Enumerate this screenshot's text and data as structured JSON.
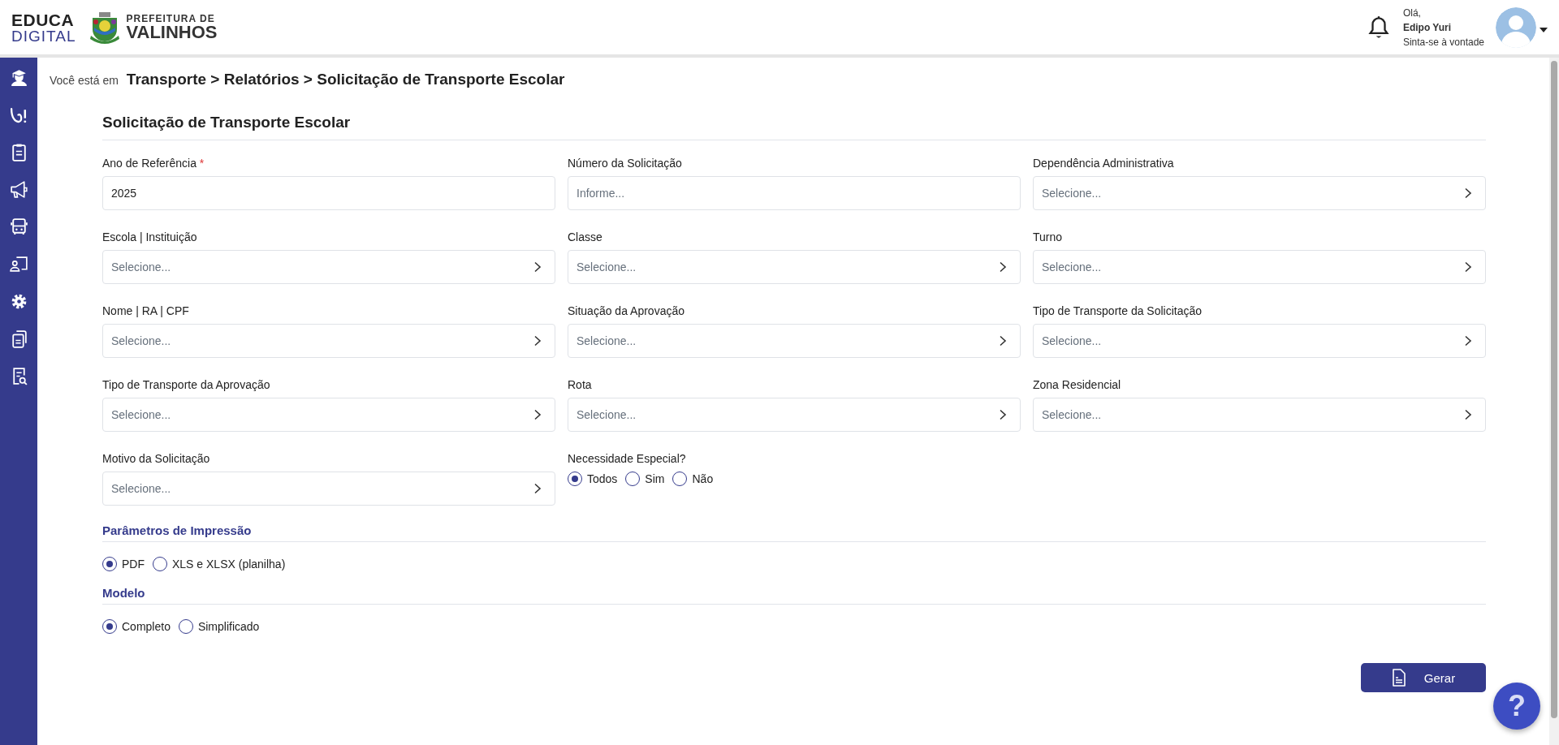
{
  "header": {
    "brand": {
      "line1": "EDUCA",
      "line2": "DIGITAL"
    },
    "city": {
      "line1": "PREFEITURA DE",
      "line2": "VALINHOS"
    },
    "user": {
      "greeting": "Olá,",
      "name": "Edipo Yuri",
      "subtitle": "Sinta-se à vontade"
    }
  },
  "breadcrumb": {
    "prefix": "Você está em",
    "path": "Transporte > Relatórios > Solicitação de Transporte Escolar"
  },
  "form": {
    "title": "Solicitação de Transporte Escolar",
    "fields": [
      {
        "kind": "text",
        "label": "Ano de Referência",
        "required_mark": "*",
        "value": "2025"
      },
      {
        "kind": "input",
        "label": "Número da Solicitação",
        "placeholder": "Informe..."
      },
      {
        "kind": "select",
        "label": "Dependência Administrativa",
        "placeholder": "Selecione..."
      },
      {
        "kind": "select",
        "label": "Escola | Instituição",
        "placeholder": "Selecione..."
      },
      {
        "kind": "select",
        "label": "Classe",
        "placeholder": "Selecione..."
      },
      {
        "kind": "select",
        "label": "Turno",
        "placeholder": "Selecione..."
      },
      {
        "kind": "select",
        "label": "Nome | RA | CPF",
        "placeholder": "Selecione..."
      },
      {
        "kind": "select",
        "label": "Situação da Aprovação",
        "placeholder": "Selecione..."
      },
      {
        "kind": "select",
        "label": "Tipo de Transporte da Solicitação",
        "placeholder": "Selecione..."
      },
      {
        "kind": "select",
        "label": "Tipo de Transporte da Aprovação",
        "placeholder": "Selecione..."
      },
      {
        "kind": "select",
        "label": "Rota",
        "placeholder": "Selecione..."
      },
      {
        "kind": "select",
        "label": "Zona Residencial",
        "placeholder": "Selecione..."
      },
      {
        "kind": "select",
        "label": "Motivo da Solicitação",
        "placeholder": "Selecione..."
      },
      {
        "kind": "radio",
        "label": "Necessidade Especial?",
        "options": [
          {
            "label": "Todos",
            "selected": true
          },
          {
            "label": "Sim",
            "selected": false
          },
          {
            "label": "Não",
            "selected": false
          }
        ]
      }
    ]
  },
  "sections": [
    {
      "title": "Parâmetros de Impressão",
      "options": [
        {
          "label": "PDF",
          "selected": true
        },
        {
          "label": "XLS e XLSX (planilha)",
          "selected": false
        }
      ]
    },
    {
      "title": "Modelo",
      "options": [
        {
          "label": "Completo",
          "selected": true
        },
        {
          "label": "Simplificado",
          "selected": false
        }
      ]
    }
  ],
  "button": {
    "label": "Gerar"
  },
  "help": {
    "label": "?"
  }
}
